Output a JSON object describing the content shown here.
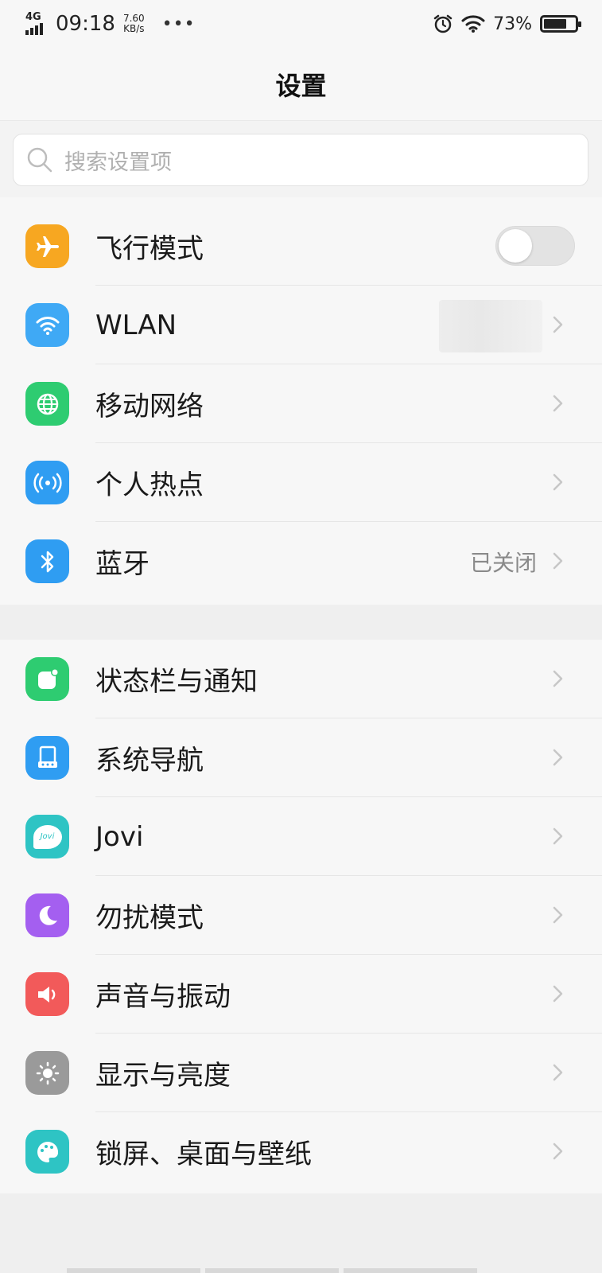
{
  "status_bar": {
    "network": "4G",
    "time": "09:18",
    "speed_value": "7.60",
    "speed_unit": "KB/s",
    "more": "•••",
    "battery_percent": "73%",
    "battery_level": 0.73
  },
  "header": {
    "title": "设置"
  },
  "search": {
    "placeholder": "搜索设置项"
  },
  "colors": {
    "airplane": "#f7a721",
    "wlan": "#3fa9f5",
    "mobile": "#2ecc71",
    "hotspot": "#2f9df2",
    "bluetooth": "#2f9df2",
    "statusbar_notify": "#2ecc71",
    "navigation": "#2f9df2",
    "jovi": "#2ec4c4",
    "dnd": "#a45ff0",
    "sound": "#f25a5a",
    "display": "#9a9a9a",
    "lockscreen": "#2ec4c4"
  },
  "group1": [
    {
      "label": "飞行模式",
      "icon": "airplane-icon",
      "control": "toggle",
      "on": false
    },
    {
      "label": "WLAN",
      "icon": "wifi-icon",
      "value": ""
    },
    {
      "label": "移动网络",
      "icon": "globe-icon"
    },
    {
      "label": "个人热点",
      "icon": "hotspot-icon"
    },
    {
      "label": "蓝牙",
      "icon": "bluetooth-icon",
      "value": "已关闭"
    }
  ],
  "group2": [
    {
      "label": "状态栏与通知",
      "icon": "notification-icon"
    },
    {
      "label": "系统导航",
      "icon": "navigation-icon"
    },
    {
      "label": "Jovi",
      "icon": "jovi-icon",
      "icon_text": "Jovi"
    },
    {
      "label": "勿扰模式",
      "icon": "moon-icon"
    },
    {
      "label": "声音与振动",
      "icon": "speaker-icon"
    },
    {
      "label": "显示与亮度",
      "icon": "brightness-icon"
    },
    {
      "label": "锁屏、桌面与壁纸",
      "icon": "palette-icon"
    }
  ]
}
